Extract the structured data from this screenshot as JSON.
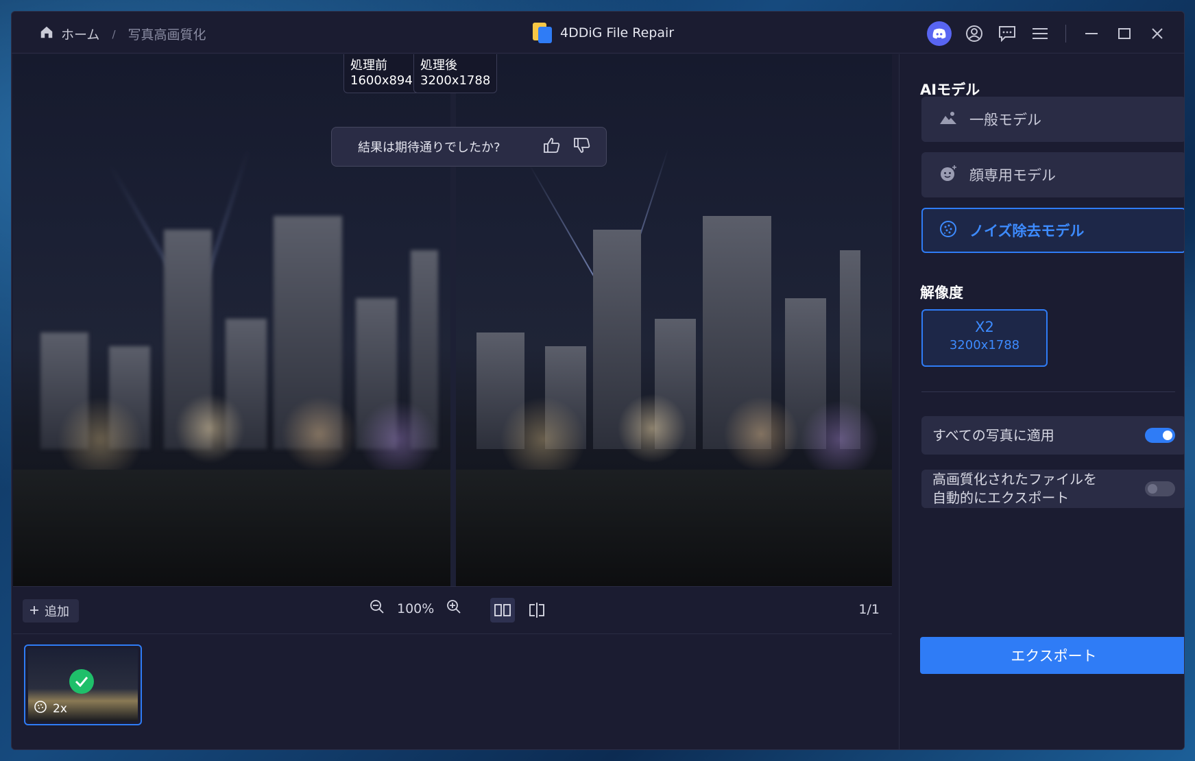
{
  "titlebar": {
    "breadcrumb_home": "ホーム",
    "breadcrumb_sep": "/",
    "breadcrumb_current": "写真高画質化",
    "app_name": "4DDiG File Repair",
    "icons": [
      "discord-icon",
      "account-icon",
      "feedback-icon",
      "menu-icon",
      "minimize-icon",
      "maximize-icon",
      "close-icon"
    ]
  },
  "viewer": {
    "before_label": "処理前",
    "before_size": "1600x894",
    "after_label": "処理後",
    "after_size": "3200x1788",
    "feedback_question": "結果は期待通りでしたか?"
  },
  "toolbar": {
    "add_label": "追加",
    "zoom_value": "100%",
    "page": "1/1"
  },
  "thumbnails": [
    {
      "badge": "2x",
      "status": "done"
    }
  ],
  "panel": {
    "ai_model_title": "AIモデル",
    "models": [
      {
        "label": "一般モデル",
        "icon": "landscape-icon",
        "selected": false
      },
      {
        "label": "顔専用モデル",
        "icon": "face-icon",
        "selected": false
      },
      {
        "label": "ノイズ除去モデル",
        "icon": "denoise-icon",
        "selected": true
      }
    ],
    "resolution_title": "解像度",
    "resolution": {
      "scale": "X2",
      "size": "3200x1788"
    },
    "apply_all_label": "すべての写真に適用",
    "apply_all_on": true,
    "auto_export_label_1": "高画質化されたファイルを",
    "auto_export_label_2": "自動的にエクスポート",
    "auto_export_on": false,
    "export_label": "エクスポート"
  },
  "colors": {
    "accent": "#2f7cf6",
    "bg": "#1b1c31",
    "card": "#2a2c45"
  }
}
